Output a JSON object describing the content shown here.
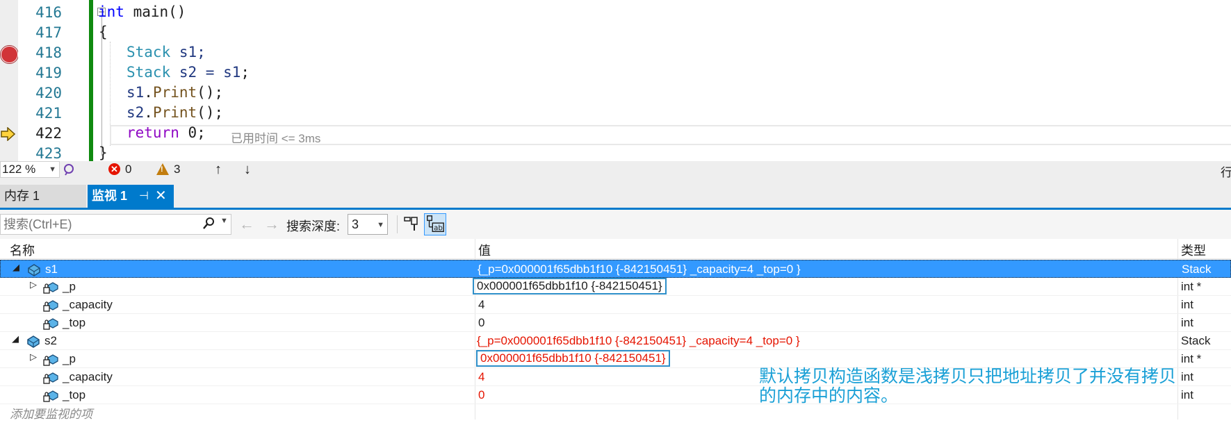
{
  "editor": {
    "line_numbers": [
      "416",
      "417",
      "418",
      "419",
      "420",
      "421",
      "422",
      "423"
    ],
    "current_line": "422",
    "breakpoint_line": "418",
    "collapse_glyph": "−",
    "code": {
      "l416_kw": "int",
      "l416_rest": " main()",
      "l417": "{",
      "l418_type": "Stack",
      "l418_rest": " s1;",
      "l419_type": "Stack",
      "l419_a": " s2 = ",
      "l419_b": "s1",
      "l419_c": ";",
      "l420_a": "s1",
      "l420_b": ".",
      "l420_c": "Print",
      "l420_d": "();",
      "l421_a": "s2",
      "l421_b": ".",
      "l421_c": "Print",
      "l421_d": "();",
      "l422_kw": "return",
      "l422_rest": " 0;",
      "l423": "}"
    },
    "perf_tip": "已用时间 <= 3ms"
  },
  "status_bar": {
    "zoom": "122 %",
    "errors": "0",
    "warnings": "3",
    "up_arrow": "↑",
    "down_arrow": "↓",
    "right_text": "行"
  },
  "tabs": {
    "memory": "内存 1",
    "watch": "监视 1",
    "pin": "⊣",
    "close": "✕"
  },
  "watch_toolbar": {
    "search_placeholder": "搜索(Ctrl+E)",
    "back": "←",
    "forward": "→",
    "depth_label": "搜索深度:",
    "depth_value": "3"
  },
  "grid": {
    "headers": {
      "name": "名称",
      "value": "值",
      "type": "类型"
    },
    "rows": [
      {
        "name": "s1",
        "value": "{_p=0x000001f65dbb1f10 {-842150451} _capacity=4 _top=0 }",
        "type": "Stack"
      },
      {
        "name": "_p",
        "value": "0x000001f65dbb1f10 {-842150451}",
        "type": "int *"
      },
      {
        "name": "_capacity",
        "value": "4",
        "type": "int"
      },
      {
        "name": "_top",
        "value": "0",
        "type": "int"
      },
      {
        "name": "s2",
        "value": "{_p=0x000001f65dbb1f10 {-842150451} _capacity=4 _top=0 }",
        "type": "Stack"
      },
      {
        "name": "_p",
        "value": "0x000001f65dbb1f10 {-842150451}",
        "type": "int *"
      },
      {
        "name": "_capacity",
        "value": "4",
        "type": "int"
      },
      {
        "name": "_top",
        "value": "0",
        "type": "int"
      }
    ],
    "add_watch": "添加要监视的项"
  },
  "annotation": {
    "line1": "默认拷贝构造函数是浅拷贝只把地址拷贝了并没有拷贝",
    "line2": "的内存中的内容。"
  },
  "colors": {
    "accent": "#007acc",
    "selection": "#3399ff",
    "changed_value": "#e51400",
    "annotation": "#1aa0d6",
    "breakpoint": "#d13438"
  }
}
